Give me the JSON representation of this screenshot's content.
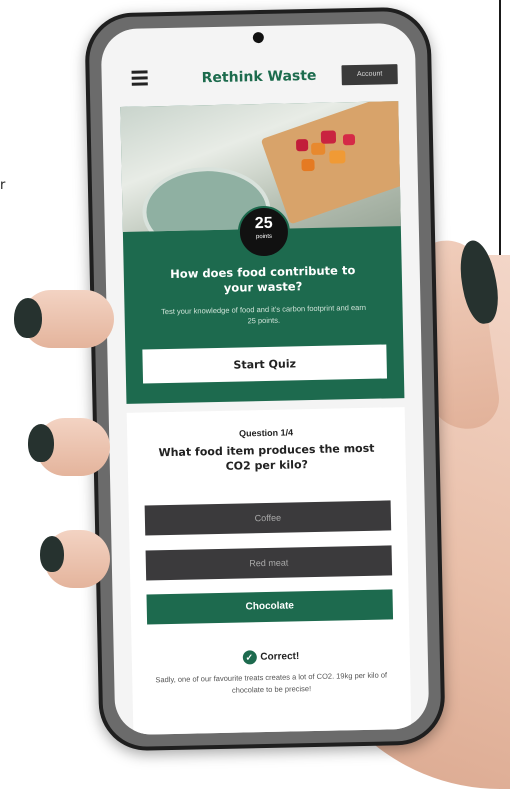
{
  "page": {
    "edge_letter": "r"
  },
  "header": {
    "title": "Rethink Waste",
    "account_label": "Account"
  },
  "quiz_card": {
    "points_value": "25",
    "points_unit": "points",
    "heading": "How does food contribute to your waste?",
    "subheading": "Test your knowledge of food and it's carbon footprint and earn 25 points.",
    "start_label": "Start Quiz"
  },
  "question": {
    "number": "Question 1/4",
    "text": "What food item produces the most CO2 per kilo?",
    "answers": [
      {
        "label": "Coffee",
        "state": "default"
      },
      {
        "label": "Red meat",
        "state": "default"
      },
      {
        "label": "Chocolate",
        "state": "selected-correct"
      }
    ],
    "result_label": "Correct!",
    "explanation": "Sadly, one of our favourite treats creates a lot of CO2. 19kg per kilo of chocolate to be precise!"
  },
  "colors": {
    "brand_green": "#1d6a4e",
    "answer_dark": "#3b3a3c"
  },
  "icons": {
    "menu": "hamburger-icon",
    "result": "check-circle-icon"
  }
}
